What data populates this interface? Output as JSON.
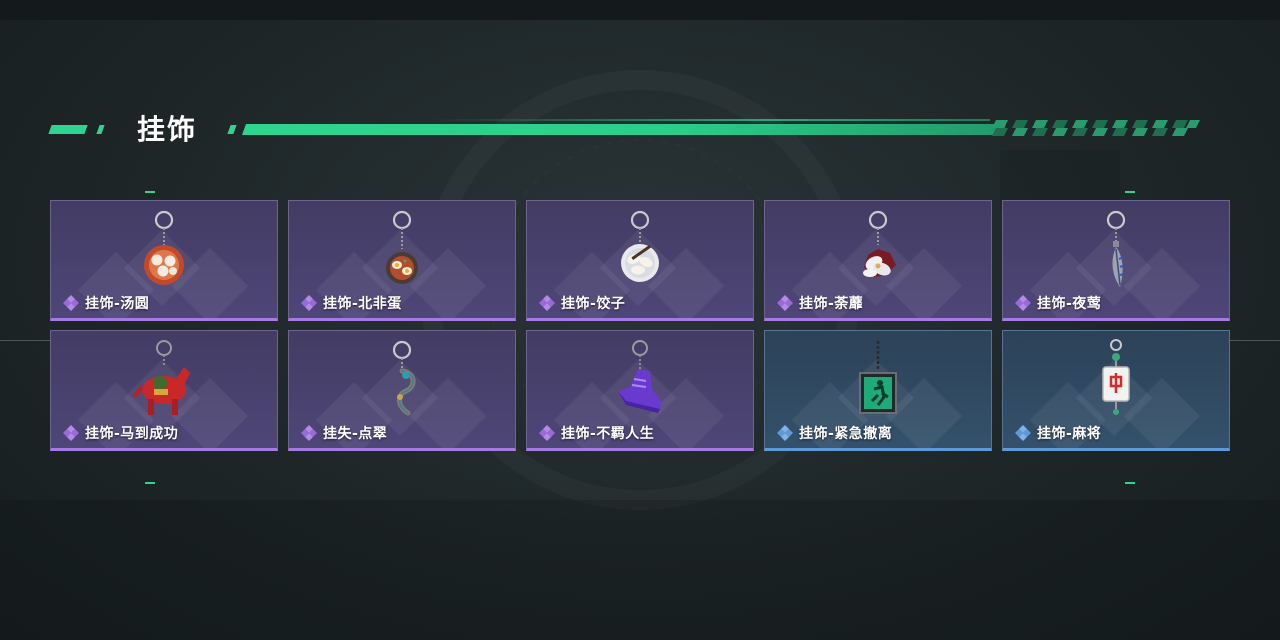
{
  "section": {
    "title": "挂饰"
  },
  "colors": {
    "accent": "#2fd58f",
    "epic": "#a67ae3",
    "rare": "#5e9ad8"
  },
  "items": [
    {
      "name": "挂饰-汤圆",
      "rarity": "epic",
      "icon": "tangyuan-bowl-charm-icon"
    },
    {
      "name": "挂饰-北非蛋",
      "rarity": "epic",
      "icon": "shakshuka-pan-charm-icon"
    },
    {
      "name": "挂饰-饺子",
      "rarity": "epic",
      "icon": "dumpling-plate-charm-icon"
    },
    {
      "name": "挂饰-荼蘼",
      "rarity": "epic",
      "icon": "flower-charm-icon"
    },
    {
      "name": "挂饰-夜莺",
      "rarity": "epic",
      "icon": "feather-charm-icon"
    },
    {
      "name": "挂饰-马到成功",
      "rarity": "epic",
      "icon": "red-horse-charm-icon"
    },
    {
      "name": "挂失-点翠",
      "rarity": "epic",
      "icon": "kingfisher-charm-icon"
    },
    {
      "name": "挂饰-不羁人生",
      "rarity": "epic",
      "icon": "purple-sneaker-charm-icon"
    },
    {
      "name": "挂饰-紧急撤离",
      "rarity": "rare",
      "icon": "exit-sign-charm-icon"
    },
    {
      "name": "挂饰-麻将",
      "rarity": "rare",
      "icon": "mahjong-tile-charm-icon"
    }
  ]
}
